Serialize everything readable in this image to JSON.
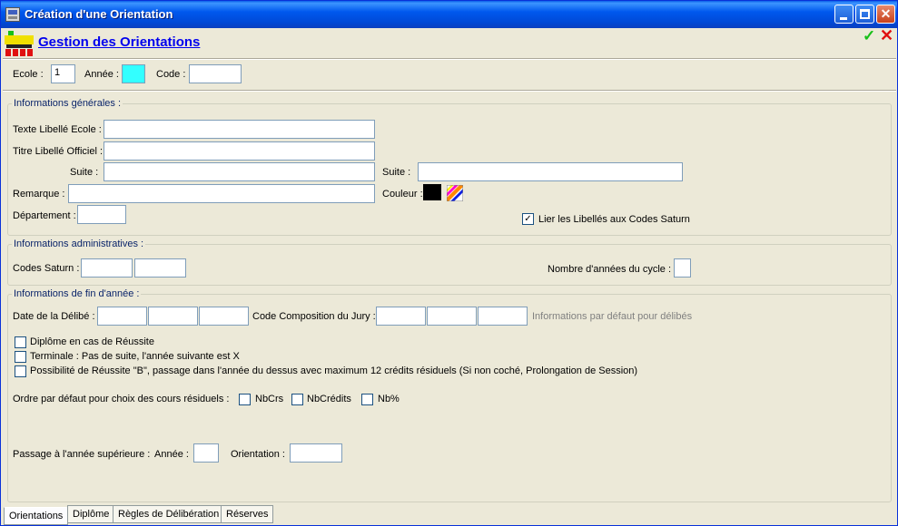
{
  "window": {
    "title": "Création d'une Orientation"
  },
  "header": {
    "title": "Gestion des Orientations"
  },
  "top": {
    "ecole_label": "Ecole :",
    "ecole_value": "1",
    "annee_label": "Année :",
    "annee_value": "",
    "code_label": "Code :",
    "code_value": ""
  },
  "general": {
    "legend": "Informations générales :",
    "texte_libelle_label": "Texte Libellé Ecole :",
    "titre_libelle_label": "Titre Libellé Officiel :",
    "suite_left_label": "Suite :",
    "suite_right_label": "Suite :",
    "remarque_label": "Remarque :",
    "couleur_label": "Couleur :",
    "couleur_value": "#000000",
    "departement_label": "Département :",
    "lier_label": "Lier les Libellés aux Codes Saturn",
    "lier_checked": true
  },
  "admin": {
    "legend": "Informations administratives :",
    "codes_saturn_label": "Codes Saturn :",
    "nombre_annees_label": "Nombre d'années du cycle :"
  },
  "fin": {
    "legend": "Informations de fin d'année :",
    "date_delibe_label": "Date de la Délibé :",
    "code_compo_label": "Code Composition du Jury :",
    "info_defaut": "Informations par défaut pour délibés",
    "diplome_label": "Diplôme en cas de Réussite",
    "terminale_label": "Terminale : Pas de suite, l'année suivante est X",
    "possibilite_label": "Possibilité de Réussite \"B\", passage dans l'année du dessus avec maximum 12 crédits résiduels (Si non coché, Prolongation de Session)",
    "ordre_label": "Ordre par défaut pour choix des cours résiduels :",
    "nbcrs_label": "NbCrs",
    "nbcredits_label": "NbCrédits",
    "nbpct_label": "Nb%",
    "passage_label": "Passage à l'année supérieure :",
    "annee_label": "Année :",
    "orientation_label": "Orientation :"
  },
  "tabs": [
    {
      "label": "Orientations",
      "active": true
    },
    {
      "label": "Diplôme",
      "active": false
    },
    {
      "label": "Règles de Délibération",
      "active": false
    },
    {
      "label": "Réserves",
      "active": false
    }
  ],
  "colors": {
    "titlebar": "#0058ee",
    "link": "#0000ee",
    "legend": "#0a246a",
    "annee_field": "#33ffff"
  },
  "icons": [
    "app-icon",
    "minimize-icon",
    "maximize-icon",
    "close-icon",
    "orientation-grid-icon",
    "check-ok-icon",
    "cancel-x-icon",
    "color-palette-icon"
  ]
}
